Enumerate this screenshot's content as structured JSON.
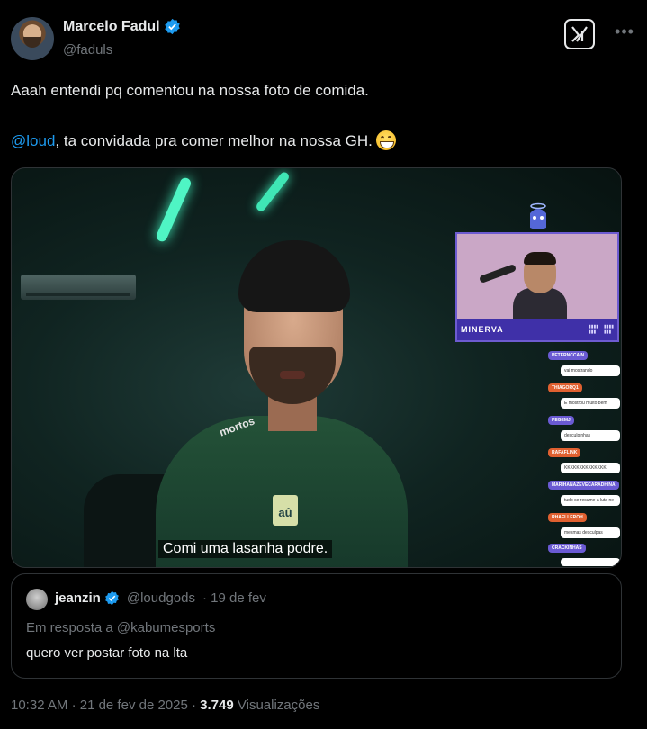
{
  "author": {
    "name": "Marcelo Fadul",
    "handle": "@faduls",
    "verified": true,
    "grok_icon": "grok-icon",
    "more_icon": "more-icon"
  },
  "tweet": {
    "line1": "Aaah entendi pq comentou na nossa foto de comida.",
    "mention": "@loud",
    "line2_rest": ", ta convidada pra comer melhor na nossa GH.",
    "emoji": "grinning-face-emoji"
  },
  "media": {
    "subtitle": "Comi uma lasanha podre.",
    "shirt_text": "mortos",
    "shirt_logo": "aû",
    "cam_name": "MINERVA",
    "chat": [
      {
        "user": "PETERNCCAIN",
        "msg": "vai mostrando",
        "color": "#6a5ad3"
      },
      {
        "user": "THIAGORQ1",
        "msg": "E mostrou muito bem",
        "color": "#e06030"
      },
      {
        "user": "PEGEMJ",
        "msg": "desculpinhas",
        "color": "#6a5ad3"
      },
      {
        "user": "RAFAFLINK",
        "msg": "KKKKKKKKKKKKKK",
        "color": "#e06030"
      },
      {
        "user": "MARIHANAZEVECARADHINA",
        "msg": "tudo se resume a luta ne",
        "color": "#6a5ad3"
      },
      {
        "user": "RHAELLEROH",
        "msg": "mesmas desculpas",
        "color": "#e06030"
      },
      {
        "user": "CRACKINHAS",
        "msg": "",
        "color": "#6a5ad3"
      }
    ]
  },
  "quote": {
    "name": "jeanzin",
    "handle": "@loudgods",
    "date": "· 19 de fev",
    "reply_to": "Em resposta a @kabumesports",
    "text": "quero ver postar foto na lta"
  },
  "meta": {
    "time": "10:32 AM",
    "date": "· 21 de fev de 2025 ·",
    "views_count": "3.749",
    "views_label": "Visualizações"
  },
  "colors": {
    "accent": "#1d9bf0",
    "background": "#000000",
    "text": "#e7e9ea",
    "muted": "#71767b",
    "border": "#2f3336"
  }
}
